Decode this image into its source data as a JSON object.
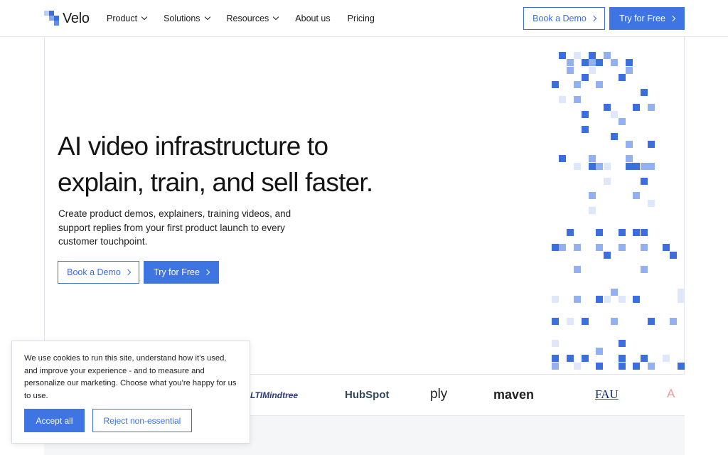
{
  "brand": {
    "name": "Velo",
    "accent": "#3f74e3"
  },
  "nav": {
    "items": [
      {
        "label": "Product",
        "dropdown": true
      },
      {
        "label": "Solutions",
        "dropdown": true
      },
      {
        "label": "Resources",
        "dropdown": true
      },
      {
        "label": "About us",
        "dropdown": false
      },
      {
        "label": "Pricing",
        "dropdown": false
      }
    ],
    "book_demo": "Book a Demo",
    "try_free": "Try for Free"
  },
  "hero": {
    "title_line1": "AI video infrastructure to",
    "title_line2": "explain, train, and sell faster.",
    "subtitle": "Create product demos, explainers, training videos, and support replies from your first product launch to every customer touchpoint.",
    "book_demo": "Book a Demo",
    "try_free": "Try for Free"
  },
  "logos": [
    "LTIMindtree",
    "HubSpot",
    "ply",
    "maven",
    "FAU",
    "A"
  ],
  "cookie": {
    "text": "We use cookies to run this site, understand how it’s used, and improve your experience - and to measure and personalize our marketing. Choose what you’re happy for us to use.",
    "accept": "Accept all",
    "reject": "Reject non-essential"
  }
}
